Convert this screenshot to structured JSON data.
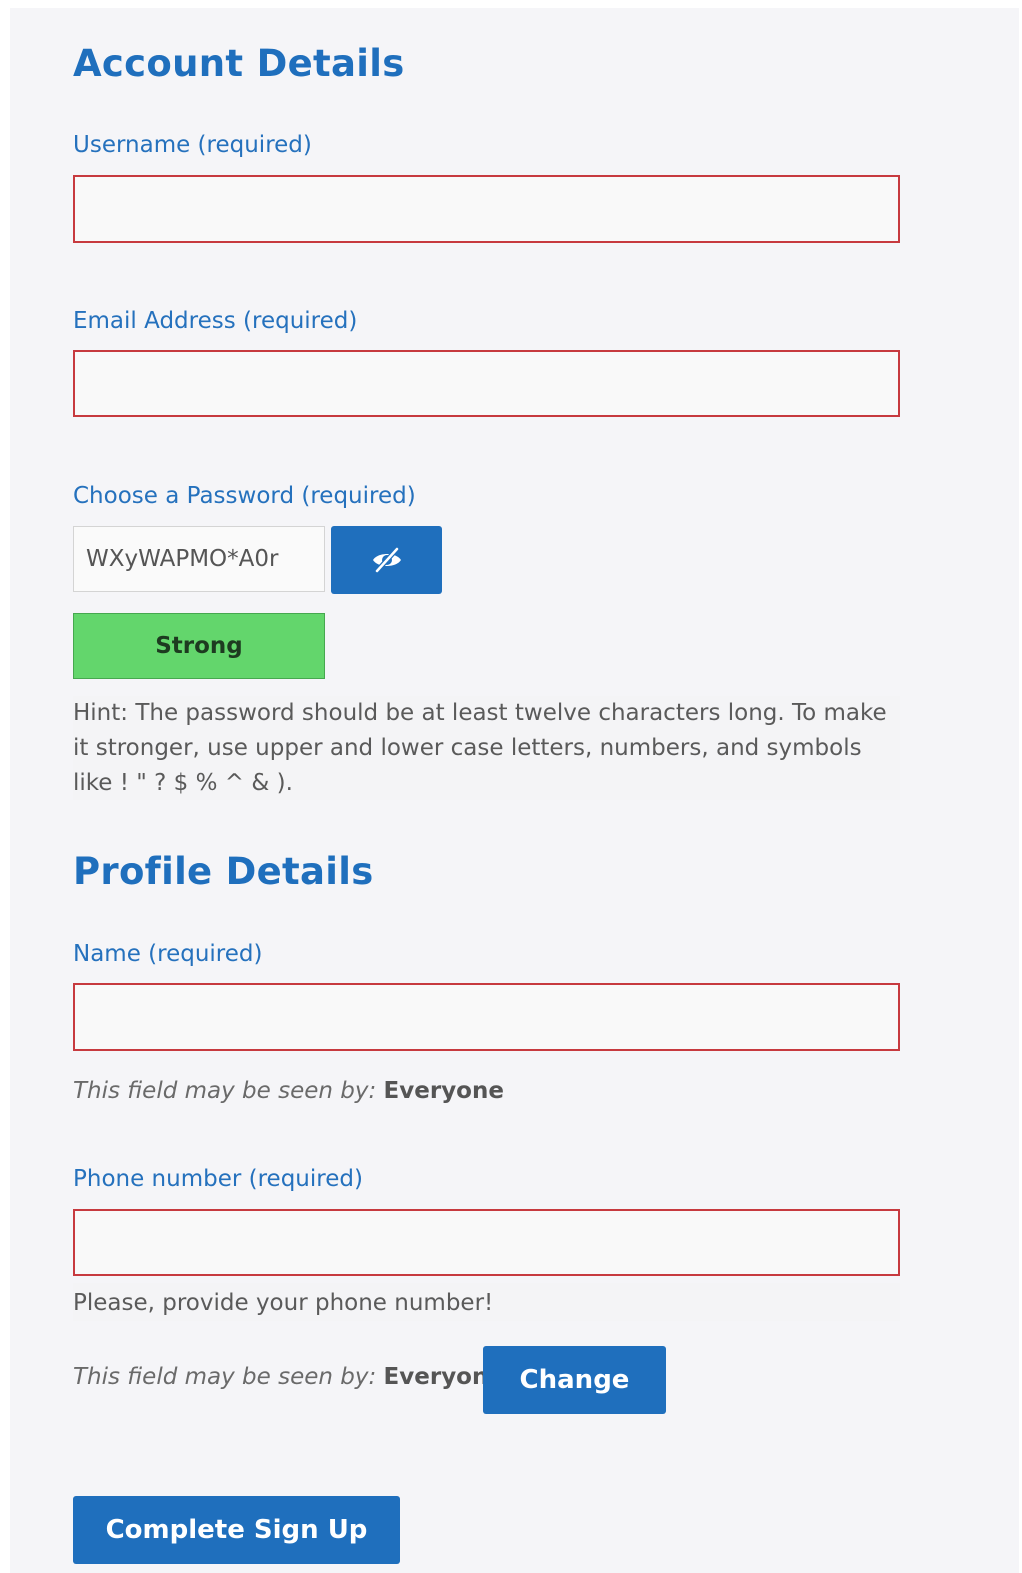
{
  "account": {
    "heading": "Account Details",
    "username_label": "Username (required)",
    "username_value": "",
    "email_label": "Email Address (required)",
    "email_value": "",
    "password_label": "Choose a Password (required)",
    "password_value": "WXyWAPMO*A0r",
    "toggle_icon": "eye-slash-icon",
    "strength_label": "Strong",
    "hint": "Hint: The password should be at least twelve characters long. To make it stronger, use upper and lower case letters, numbers, and symbols like ! \" ? $ % ^ & )."
  },
  "profile": {
    "heading": "Profile Details",
    "name_label": "Name (required)",
    "name_value": "",
    "name_visibility_prefix": "This field may be seen by:",
    "name_visibility_level": "Everyone",
    "phone_label": "Phone number (required)",
    "phone_value": "",
    "phone_description": "Please, provide your phone number!",
    "phone_visibility_prefix": "This field may be seen by:",
    "phone_visibility_level": "Everyone",
    "change_button": "Change"
  },
  "submit_button": "Complete Sign Up",
  "colors": {
    "accent": "#1f6fbd",
    "required_border": "#c73a3f",
    "strength_strong": "#63d66c"
  }
}
